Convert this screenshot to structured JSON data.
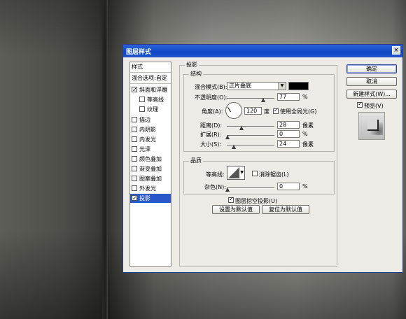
{
  "dialog": {
    "title": "图层样式",
    "close_symbol": "×"
  },
  "sidebar": {
    "items": [
      {
        "label": "样式",
        "checkbox": false,
        "checked": false,
        "selected": false
      },
      {
        "label": "混合选项:自定",
        "checkbox": false,
        "checked": false,
        "selected": false
      },
      {
        "label": "斜面和浮雕",
        "checkbox": true,
        "checked": true,
        "selected": false
      },
      {
        "label": "等高线",
        "checkbox": true,
        "checked": false,
        "selected": false
      },
      {
        "label": "纹理",
        "checkbox": true,
        "checked": false,
        "selected": false
      },
      {
        "label": "描边",
        "checkbox": true,
        "checked": false,
        "selected": false
      },
      {
        "label": "内阴影",
        "checkbox": true,
        "checked": false,
        "selected": false
      },
      {
        "label": "内发光",
        "checkbox": true,
        "checked": false,
        "selected": false
      },
      {
        "label": "光泽",
        "checkbox": true,
        "checked": false,
        "selected": false
      },
      {
        "label": "颜色叠加",
        "checkbox": true,
        "checked": false,
        "selected": false
      },
      {
        "label": "渐变叠加",
        "checkbox": true,
        "checked": false,
        "selected": false
      },
      {
        "label": "图案叠加",
        "checkbox": true,
        "checked": false,
        "selected": false
      },
      {
        "label": "外发光",
        "checkbox": true,
        "checked": false,
        "selected": false
      },
      {
        "label": "投影",
        "checkbox": true,
        "checked": true,
        "selected": true
      }
    ]
  },
  "shadow_panel": {
    "title": "投影",
    "structure": {
      "title": "结构",
      "blend_mode_label": "混合模式(B):",
      "blend_mode_value": "正片叠底",
      "blend_color": "#000000",
      "opacity_label": "不透明度(O):",
      "opacity_value": "77",
      "opacity_unit": "%",
      "angle_label": "角度(A):",
      "angle_value": "120",
      "angle_unit": "度",
      "global_light_label": "使用全局光(G)",
      "global_light_checked": true,
      "distance_label": "距离(D):",
      "distance_value": "28",
      "distance_unit": "像素",
      "spread_label": "扩展(R):",
      "spread_value": "0",
      "spread_unit": "%",
      "size_label": "大小(S):",
      "size_value": "24",
      "size_unit": "像素"
    },
    "quality": {
      "title": "品质",
      "contour_label": "等高线:",
      "antialias_label": "消除锯齿(L)",
      "antialias_checked": false,
      "noise_label": "杂色(N):",
      "noise_value": "0",
      "noise_unit": "%"
    },
    "knockout_label": "图层挖空投影(U)",
    "knockout_checked": true,
    "make_default_label": "设置为默认值",
    "reset_default_label": "复位为默认值"
  },
  "buttons": {
    "ok": "确定",
    "cancel": "取消",
    "new_style": "新建样式(W)...",
    "preview_label": "预览(V)",
    "preview_checked": true
  }
}
